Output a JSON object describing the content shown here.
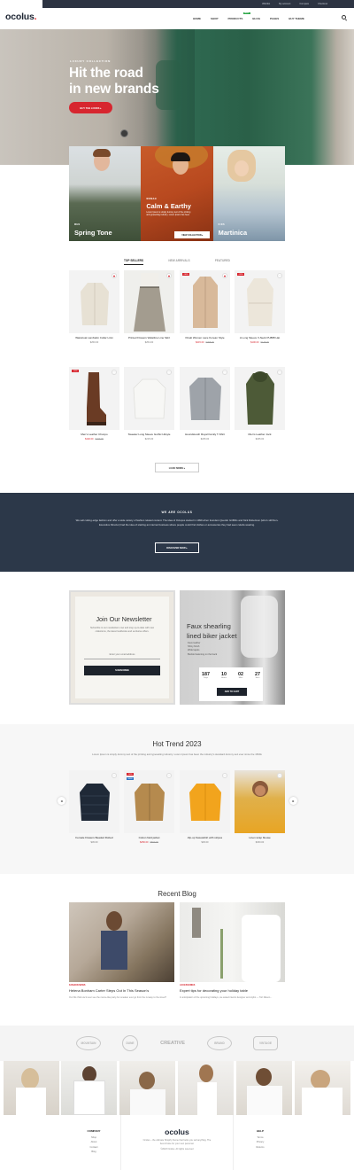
{
  "topbar": {
    "items": [
      "Wishlist",
      "My account",
      "Compare",
      "Checkout"
    ]
  },
  "header": {
    "logo": "ocolus",
    "logo_dot": ".",
    "nav": [
      "HOME",
      "SHOP",
      "PRODUCTS",
      "BLOG",
      "PAGES",
      "BUY THEME"
    ],
    "hot_badge": "HOT"
  },
  "hero": {
    "subtitle": "LUXURY COLLECTION",
    "title_line1": "Hit the road",
    "title_line2": "in new brands",
    "cta": "BUY THE LOOKS ▸"
  },
  "collections": [
    {
      "tag": "MEN",
      "name": "Spring Tone"
    },
    {
      "tag": "WOMAN",
      "name": "Calm & Earthy",
      "desc": "Lorem Ipsum is simply dummy text of the printing and typesetting industry. Lorem Ipsum has been",
      "cta": "VIEW COLLECTION ▸"
    },
    {
      "tag": "KIDS",
      "name": "Martinica"
    }
  ],
  "tabs": [
    "TOP SELLERS",
    "NEW ARRIVALS",
    "FEATURED"
  ],
  "products": [
    {
      "title": "Waistcoat Lambskin Collar Linin",
      "price": "$250.00",
      "old": "",
      "badge": "",
      "fav": true
    },
    {
      "title": "Printed Flowers Waistline Line Skirt",
      "price": "$254.00",
      "old": "",
      "badge": "",
      "fav": true
    },
    {
      "title": "Khaki Women Lace Korean Style",
      "price": "$215.00",
      "old": "$308.00",
      "badge": "-30%",
      "fav": true
    },
    {
      "title": "A Long Sleeve V-Neck PU888 Hat",
      "price": "$100.00",
      "old": "$148.00",
      "badge": "-32%",
      "fav": false
    },
    {
      "title": "Men's Leather Chunpo",
      "price": "$192.00",
      "old": "$239.00",
      "badge": "-20%",
      "fav": false
    },
    {
      "title": "Sweater Long Sleeve Gothic Hitsyle",
      "price": "$215.00",
      "old": "",
      "badge": "",
      "fav": false
    },
    {
      "title": "Houndstooth Royal Family T-Shirt",
      "price": "$235.00",
      "old": "",
      "badge": "",
      "fav": false
    },
    {
      "title": "Men's Leather Jock",
      "price": "$235.00",
      "old": "",
      "badge": "",
      "fav": false
    }
  ],
  "load_more": "LOAD MORE ▸",
  "about": {
    "title": "WE ARE OCOLUS",
    "text": "We sell cutting-edge fashion and offer a wide variety of fashion related content. The idea of Octopus started in 1999 when founders Quentin Griffiths and Nick Robertson (who's still Non-Executive Director) had the idea of starting an internet business where people could find clothes or accessories they had seen celebs wearing.",
    "cta": "DISCOVER NOW ▸"
  },
  "newsletter": {
    "title": "Join Our Newsletter",
    "text": "Subscribe to our newsletters now and stay up-to-date with new collections, the latest lookbooks and exclusive offers.",
    "placeholder": "Enter your email address",
    "button": "SUBSCRIBE"
  },
  "promo": {
    "title_line1": "Faux shearling",
    "title_line2": "lined biker jacket",
    "features": [
      "Faux leather",
      "Shiny finish",
      "Wide lapels",
      "Buckle fastening on the back"
    ],
    "countdown": [
      {
        "value": "187",
        "unit": "Days"
      },
      {
        "value": "10",
        "unit": "Hours"
      },
      {
        "value": "02",
        "unit": "Mins"
      },
      {
        "value": "27",
        "unit": "Secs"
      }
    ],
    "button": "ADD TO CART"
  },
  "trend": {
    "title": "Hot Trend 2023",
    "text": "Lorem Ipsum is simply dummy text of the printing and typesetting industry. Lorem Ipsum has been the industry's standard dummy text ever since the 1500s",
    "prev": "◂",
    "next": "▸",
    "items": [
      {
        "title": "Female Flowers Beaded Robed",
        "price": "$45.00",
        "old": "",
        "badge": ""
      },
      {
        "title": "Cotton field jacket",
        "price": "$250.00",
        "old": "$500.00",
        "badge": "-50%",
        "badge2": "NEW"
      },
      {
        "title": "Zip-up Sweatshirt with stripes",
        "price": "$45.00",
        "old": "",
        "badge": ""
      },
      {
        "title": "Linen wrap blouse",
        "price": "$150.00",
        "old": "",
        "badge": ""
      }
    ]
  },
  "blog": {
    "title": "Recent Blog",
    "posts": [
      {
        "cat": "FASHION NEWS",
        "title": "Helena Bonham Carter Steps Out In This Season's",
        "excerpt": "Our We think we'd ever see the meme-like party-fun sneaker ever go from the runway to the street?"
      },
      {
        "cat": "ACCESSORIES",
        "title": "Expert tips for decorating your holiday table",
        "excerpt": "In anticipation of the upcoming holidays, we asked interior designer and stylist — Tori Mason..."
      }
    ]
  },
  "brands": [
    "MOUNTAIN",
    "DUNE",
    "CREATIVE",
    "BRAND",
    "VINTAGE"
  ],
  "footer": {
    "company_title": "COMPANY",
    "company_links": [
      "Shop",
      "About",
      "Contact",
      "Blog"
    ],
    "logo": "ocolus",
    "about": "Ocolus – the ultimate Shopify theme that helps you sell anything. The best choice for your next personal.",
    "copyright": "©2023 Ocolus. All rights reserved",
    "help_title": "HELP",
    "help_links": [
      "Terms",
      "Privacy",
      "Returns"
    ]
  },
  "colors": {
    "accent": "#d7262f",
    "navy": "#2c3849",
    "green_badge": "#31a94b"
  }
}
